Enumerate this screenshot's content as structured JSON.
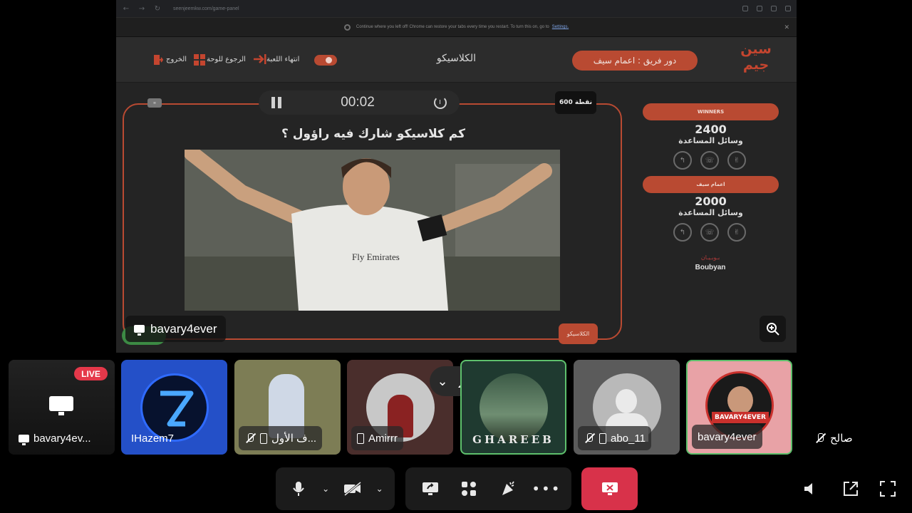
{
  "browser": {
    "url": "seenjeemkw.com/game-panel",
    "restore_message": "Continue where you left off! Chrome can restore your tabs every time you restart. To turn this on, go to",
    "restore_link": "Settings."
  },
  "game": {
    "logo_text": "سين جيم",
    "turn_label": "دور فريق : اعمام سيف",
    "title": "الكلاسيكو",
    "exit_label": "الخروج",
    "back_label": "الرجوع للوحة",
    "end_label": "انتهاء اللعبة",
    "timer": "00:02",
    "points": "600 نقطة",
    "question": "كم كلاسيكو شارك فيه راؤول ؟",
    "category_tag": "الكلاسيكو",
    "teams": [
      {
        "name": "WINNERS",
        "score": "2400",
        "lifelines_label": "وسائل المساعدة"
      },
      {
        "name": "اعمام سيف",
        "score": "2000",
        "lifelines_label": "وسائل المساعدة"
      }
    ],
    "sponsor_arabic": "بـوبـيـان",
    "sponsor_latin": "Boubyan",
    "presenter": "bavary4ever"
  },
  "participants": [
    {
      "name": "bavary4ev...",
      "live": "LIVE"
    },
    {
      "name": "IHazem7"
    },
    {
      "name": "ف الأول..."
    },
    {
      "name": "Amirrr"
    },
    {
      "name": "GHAREEB"
    },
    {
      "name": "abo_11"
    },
    {
      "name": "bavary4ever"
    },
    {
      "name": "صالح"
    }
  ],
  "colors": {
    "accent": "#b94a32",
    "live": "#e5384a",
    "leave": "#d8324a",
    "speaking": "#5ec06c"
  },
  "icons": [
    "microphone-icon",
    "camera-off-icon",
    "share-screen-icon",
    "activities-icon",
    "soundboard-icon",
    "more-icon",
    "leave-call-icon",
    "volume-icon",
    "popout-icon",
    "fullscreen-icon",
    "zoom-in-icon",
    "people-icon"
  ]
}
